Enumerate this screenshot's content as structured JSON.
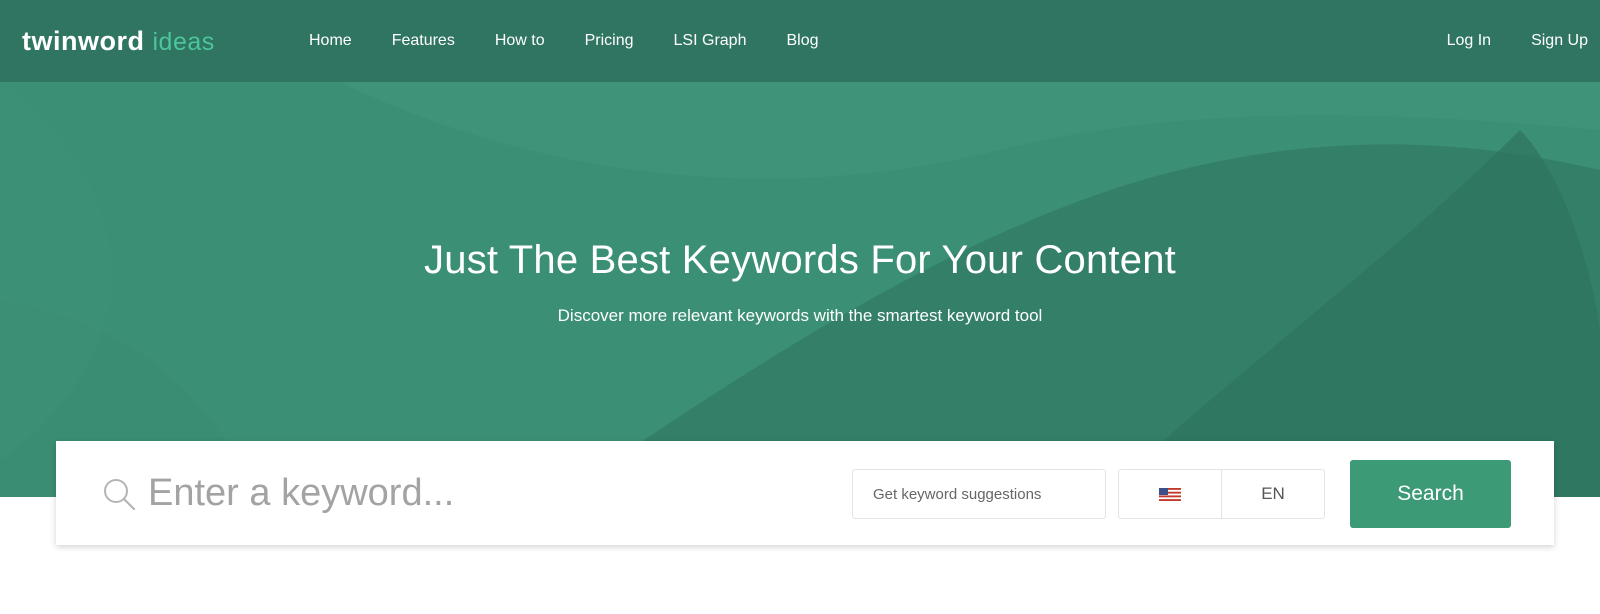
{
  "brand": {
    "logo_main": "twinword",
    "logo_sub": "ideas",
    "accent_color": "#4cc59a"
  },
  "nav": {
    "links": [
      {
        "label": "Home"
      },
      {
        "label": "Features"
      },
      {
        "label": "How to"
      },
      {
        "label": "Pricing"
      },
      {
        "label": "LSI Graph"
      },
      {
        "label": "Blog"
      }
    ],
    "login_label": "Log In",
    "signup_label": "Sign Up"
  },
  "hero": {
    "title": "Just The Best Keywords For Your Content",
    "subtitle": "Discover more relevant keywords with the smartest keyword tool",
    "background_color": "#3b8f74"
  },
  "search": {
    "placeholder": "Enter a keyword...",
    "value": "",
    "mode_selected": "Get keyword suggestions",
    "country_icon": "us-flag-icon",
    "language": "EN",
    "button_label": "Search",
    "button_color": "#3d9a76"
  }
}
